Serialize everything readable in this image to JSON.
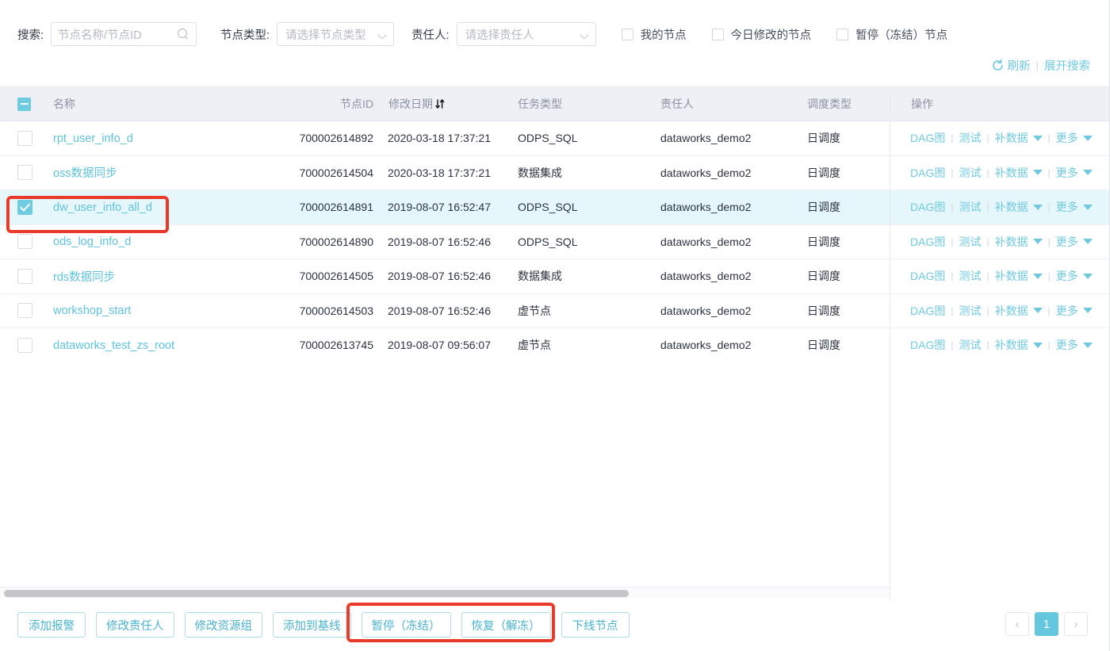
{
  "search": {
    "search_label": "搜索:",
    "search_placeholder": "节点名称/节点ID",
    "search_value": "",
    "search_icon": "search-icon",
    "node_type_label": "节点类型:",
    "node_type_placeholder": "请选择节点类型",
    "owner_label": "责任人:",
    "owner_placeholder": "请选择责任人",
    "checkboxes": [
      {
        "label": "我的节点",
        "checked": false
      },
      {
        "label": "今日修改的节点",
        "checked": false
      },
      {
        "label": "暂停（冻结）节点",
        "checked": false
      }
    ],
    "refresh_label": "刷新",
    "refresh_icon": "refresh-icon",
    "expand_label": "展开搜索",
    "divider": "|"
  },
  "table": {
    "header_checkbox_state": "indeterminate",
    "columns": [
      {
        "key": "name",
        "label": "名称"
      },
      {
        "key": "node_id",
        "label": "节点ID"
      },
      {
        "key": "modified",
        "label": "修改日期",
        "sort_icon": "sort-updown-icon"
      },
      {
        "key": "task_type",
        "label": "任务类型"
      },
      {
        "key": "owner",
        "label": "责任人"
      },
      {
        "key": "schedule_type",
        "label": "调度类型"
      },
      {
        "key": "actions",
        "label": "操作"
      }
    ],
    "rows": [
      {
        "checked": false,
        "name": "rpt_user_info_d",
        "node_id": "700002614892",
        "modified": "2020-03-18 17:37:21",
        "task_type": "ODPS_SQL",
        "owner": "dataworks_demo2",
        "schedule_type": "日调度"
      },
      {
        "checked": false,
        "name": "oss数据同步",
        "node_id": "700002614504",
        "modified": "2020-03-18 17:37:21",
        "task_type": "数据集成",
        "owner": "dataworks_demo2",
        "schedule_type": "日调度"
      },
      {
        "checked": true,
        "name": "dw_user_info_all_d",
        "node_id": "700002614891",
        "modified": "2019-08-07 16:52:47",
        "task_type": "ODPS_SQL",
        "owner": "dataworks_demo2",
        "schedule_type": "日调度"
      },
      {
        "checked": false,
        "name": "ods_log_info_d",
        "node_id": "700002614890",
        "modified": "2019-08-07 16:52:46",
        "task_type": "ODPS_SQL",
        "owner": "dataworks_demo2",
        "schedule_type": "日调度"
      },
      {
        "checked": false,
        "name": "rds数据同步",
        "node_id": "700002614505",
        "modified": "2019-08-07 16:52:46",
        "task_type": "数据集成",
        "owner": "dataworks_demo2",
        "schedule_type": "日调度"
      },
      {
        "checked": false,
        "name": "workshop_start",
        "node_id": "700002614503",
        "modified": "2019-08-07 16:52:46",
        "task_type": "虚节点",
        "owner": "dataworks_demo2",
        "schedule_type": "日调度"
      },
      {
        "checked": false,
        "name": "dataworks_test_zs_root",
        "node_id": "700002613745",
        "modified": "2019-08-07 09:56:07",
        "task_type": "虚节点",
        "owner": "dataworks_demo2",
        "schedule_type": "日调度"
      }
    ],
    "row_actions": {
      "dag_label": "DAG图",
      "test_label": "测试",
      "backfill_label": "补数据",
      "more_label": "更多",
      "separator": "|"
    }
  },
  "footer": {
    "buttons": [
      "添加报警",
      "修改责任人",
      "修改资源组",
      "添加到基线",
      "暂停（冻结）",
      "恢复（解冻）",
      "下线节点"
    ],
    "pagination": {
      "prev": "‹",
      "current_page": "1",
      "next": "›"
    }
  },
  "annotations": {
    "highlight_color": "#e8392a",
    "boxes": [
      "selected-row-checkbox",
      "pause-resume-buttons"
    ]
  },
  "colors": {
    "accent": "#65c7de",
    "link": "#6fc9de",
    "selected_row_bg": "#e6f7fb",
    "header_bg": "#eef0f6",
    "page_bg": "#eceef5"
  }
}
